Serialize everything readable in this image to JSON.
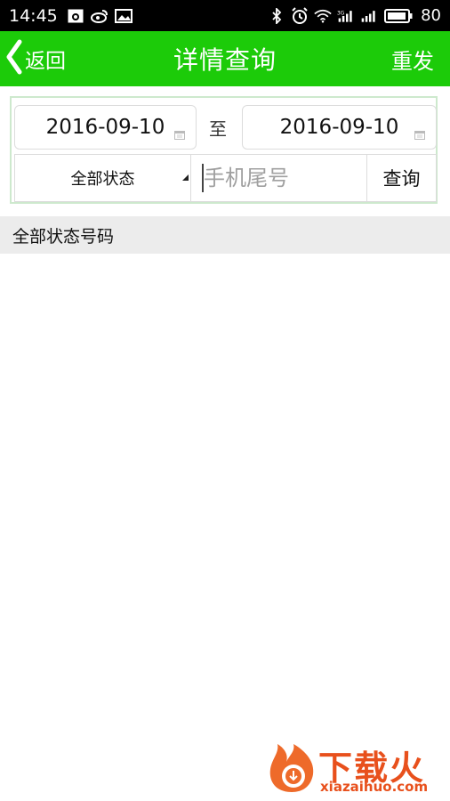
{
  "status_bar": {
    "time": "14:45",
    "battery": "80",
    "icons": [
      "gallery-icon",
      "weibo-icon",
      "image-icon",
      "bluetooth-icon",
      "alarm-icon",
      "wifi-icon",
      "signal-3g-icon",
      "signal-icon",
      "battery-icon"
    ]
  },
  "app_bar": {
    "back_label": "返回",
    "title": "详情查询",
    "resend_label": "重发",
    "color": "#1ccb09"
  },
  "filter": {
    "date_from": "2016-09-10",
    "to_label": "至",
    "date_to": "2016-09-10",
    "status_selected": "全部状态",
    "phone_placeholder": "手机尾号",
    "query_label": "查询"
  },
  "results": {
    "header": "全部状态号码"
  },
  "watermark": {
    "text": "下载火",
    "sub": "xiazaihuo.com"
  }
}
